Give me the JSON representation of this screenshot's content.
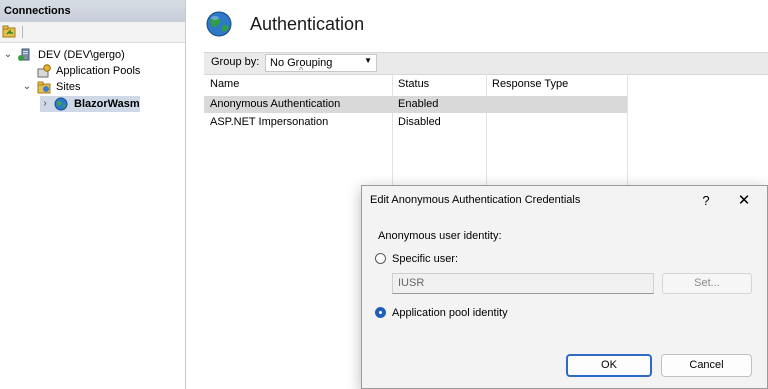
{
  "connections": {
    "header": "Connections",
    "tree": [
      {
        "label": "DEV (DEV\\gergo)",
        "icon": "server-icon",
        "expanded": true
      },
      {
        "label": "Application Pools",
        "icon": "app-pools-icon"
      },
      {
        "label": "Sites",
        "icon": "sites-folder-icon",
        "expanded": true
      },
      {
        "label": "BlazorWasm",
        "icon": "globe-icon",
        "selected": true
      }
    ]
  },
  "main": {
    "title": "Authentication",
    "title_icon": "globe-icon",
    "group_by_label": "Group by:",
    "group_by_value": "No Grouping"
  },
  "table": {
    "columns": [
      "Name",
      "Status",
      "Response Type"
    ],
    "rows": [
      {
        "name": "Anonymous Authentication",
        "status": "Enabled",
        "response_type": "",
        "selected": true
      },
      {
        "name": "ASP.NET Impersonation",
        "status": "Disabled",
        "response_type": ""
      }
    ]
  },
  "dialog": {
    "title": "Edit Anonymous Authentication Credentials",
    "help": "?",
    "close": "✕",
    "identity_label": "Anonymous user identity:",
    "specific_user_label": "Specific user:",
    "specific_user_value": "IUSR",
    "set_button": "Set...",
    "app_pool_label": "Application pool identity",
    "selected_option": "Application pool identity",
    "ok_button": "OK",
    "cancel_button": "Cancel"
  },
  "colors": {
    "accent": "#1f5fb5",
    "selected_row": "#d9d9d9",
    "tree_selected": "#cfd8e6"
  }
}
